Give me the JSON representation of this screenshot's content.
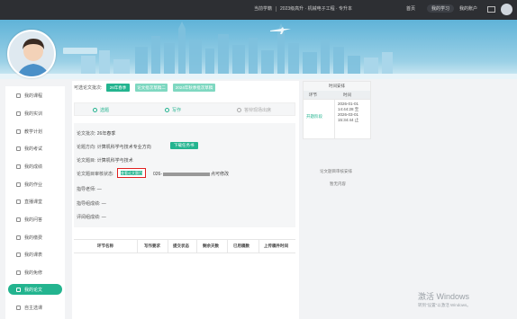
{
  "topbar": {
    "context_label": "当前学籍",
    "context_value": "2023级高升 · 机械电子工程 · 专升本",
    "nav": [
      "首页",
      "我的学习",
      "我的账户"
    ]
  },
  "sidebar": {
    "items": [
      {
        "label": "我的课程"
      },
      {
        "label": "我的实训"
      },
      {
        "label": "教学计划"
      },
      {
        "label": "我的考试"
      },
      {
        "label": "我的成绩"
      },
      {
        "label": "我的作业"
      },
      {
        "label": "直播课堂"
      },
      {
        "label": "我的问答"
      },
      {
        "label": "我的缴费"
      },
      {
        "label": "我的课表"
      },
      {
        "label": "我的免修"
      },
      {
        "label": "我的论文"
      },
      {
        "label": "自主选课"
      }
    ],
    "active_index": 11
  },
  "thesis": {
    "batch_label": "可选论文批次:",
    "batches": [
      "26年春季",
      "论文批次草稿二",
      "2024年秋季批次草稿"
    ],
    "steps": [
      "选题",
      "写作",
      "答辩现场出席"
    ],
    "fields": {
      "batch": {
        "label": "论文批次:",
        "value": "26年春季"
      },
      "direction": {
        "label": "论题方向:",
        "value": "计算机科学与技术专业方向",
        "button": "下载任务书"
      },
      "topic": {
        "label": "论文题目:",
        "value": "计算机科学与技术"
      },
      "template": {
        "label": "论文题目审核状态:",
        "button": "查看论文题目",
        "value_prefix": "026-",
        "value_suffix": "点可修改"
      },
      "teacher": {
        "label": "指导老师:",
        "value": "—"
      },
      "guidance": {
        "label": "指导组成绩:",
        "value": "—"
      },
      "defense": {
        "label": "评阅组成绩:",
        "value": "—"
      }
    },
    "table_headers": [
      "环节名称",
      "写作要求",
      "提交状态",
      "剩余天数",
      "已用稿数",
      "上传稿件时间"
    ]
  },
  "right_panel": {
    "title": "时间安排",
    "col1": "环节",
    "col2": "时间",
    "row_label": "开题阶段",
    "row_value": "2026-01-01 14:44:28 至 2026-03-01 15:34:44 止",
    "note1": "论文题目审核安排",
    "note2": "暂无内容"
  },
  "watermark": {
    "title": "激活 Windows",
    "subtitle": "转到\"设置\"以激活 Windows。"
  }
}
